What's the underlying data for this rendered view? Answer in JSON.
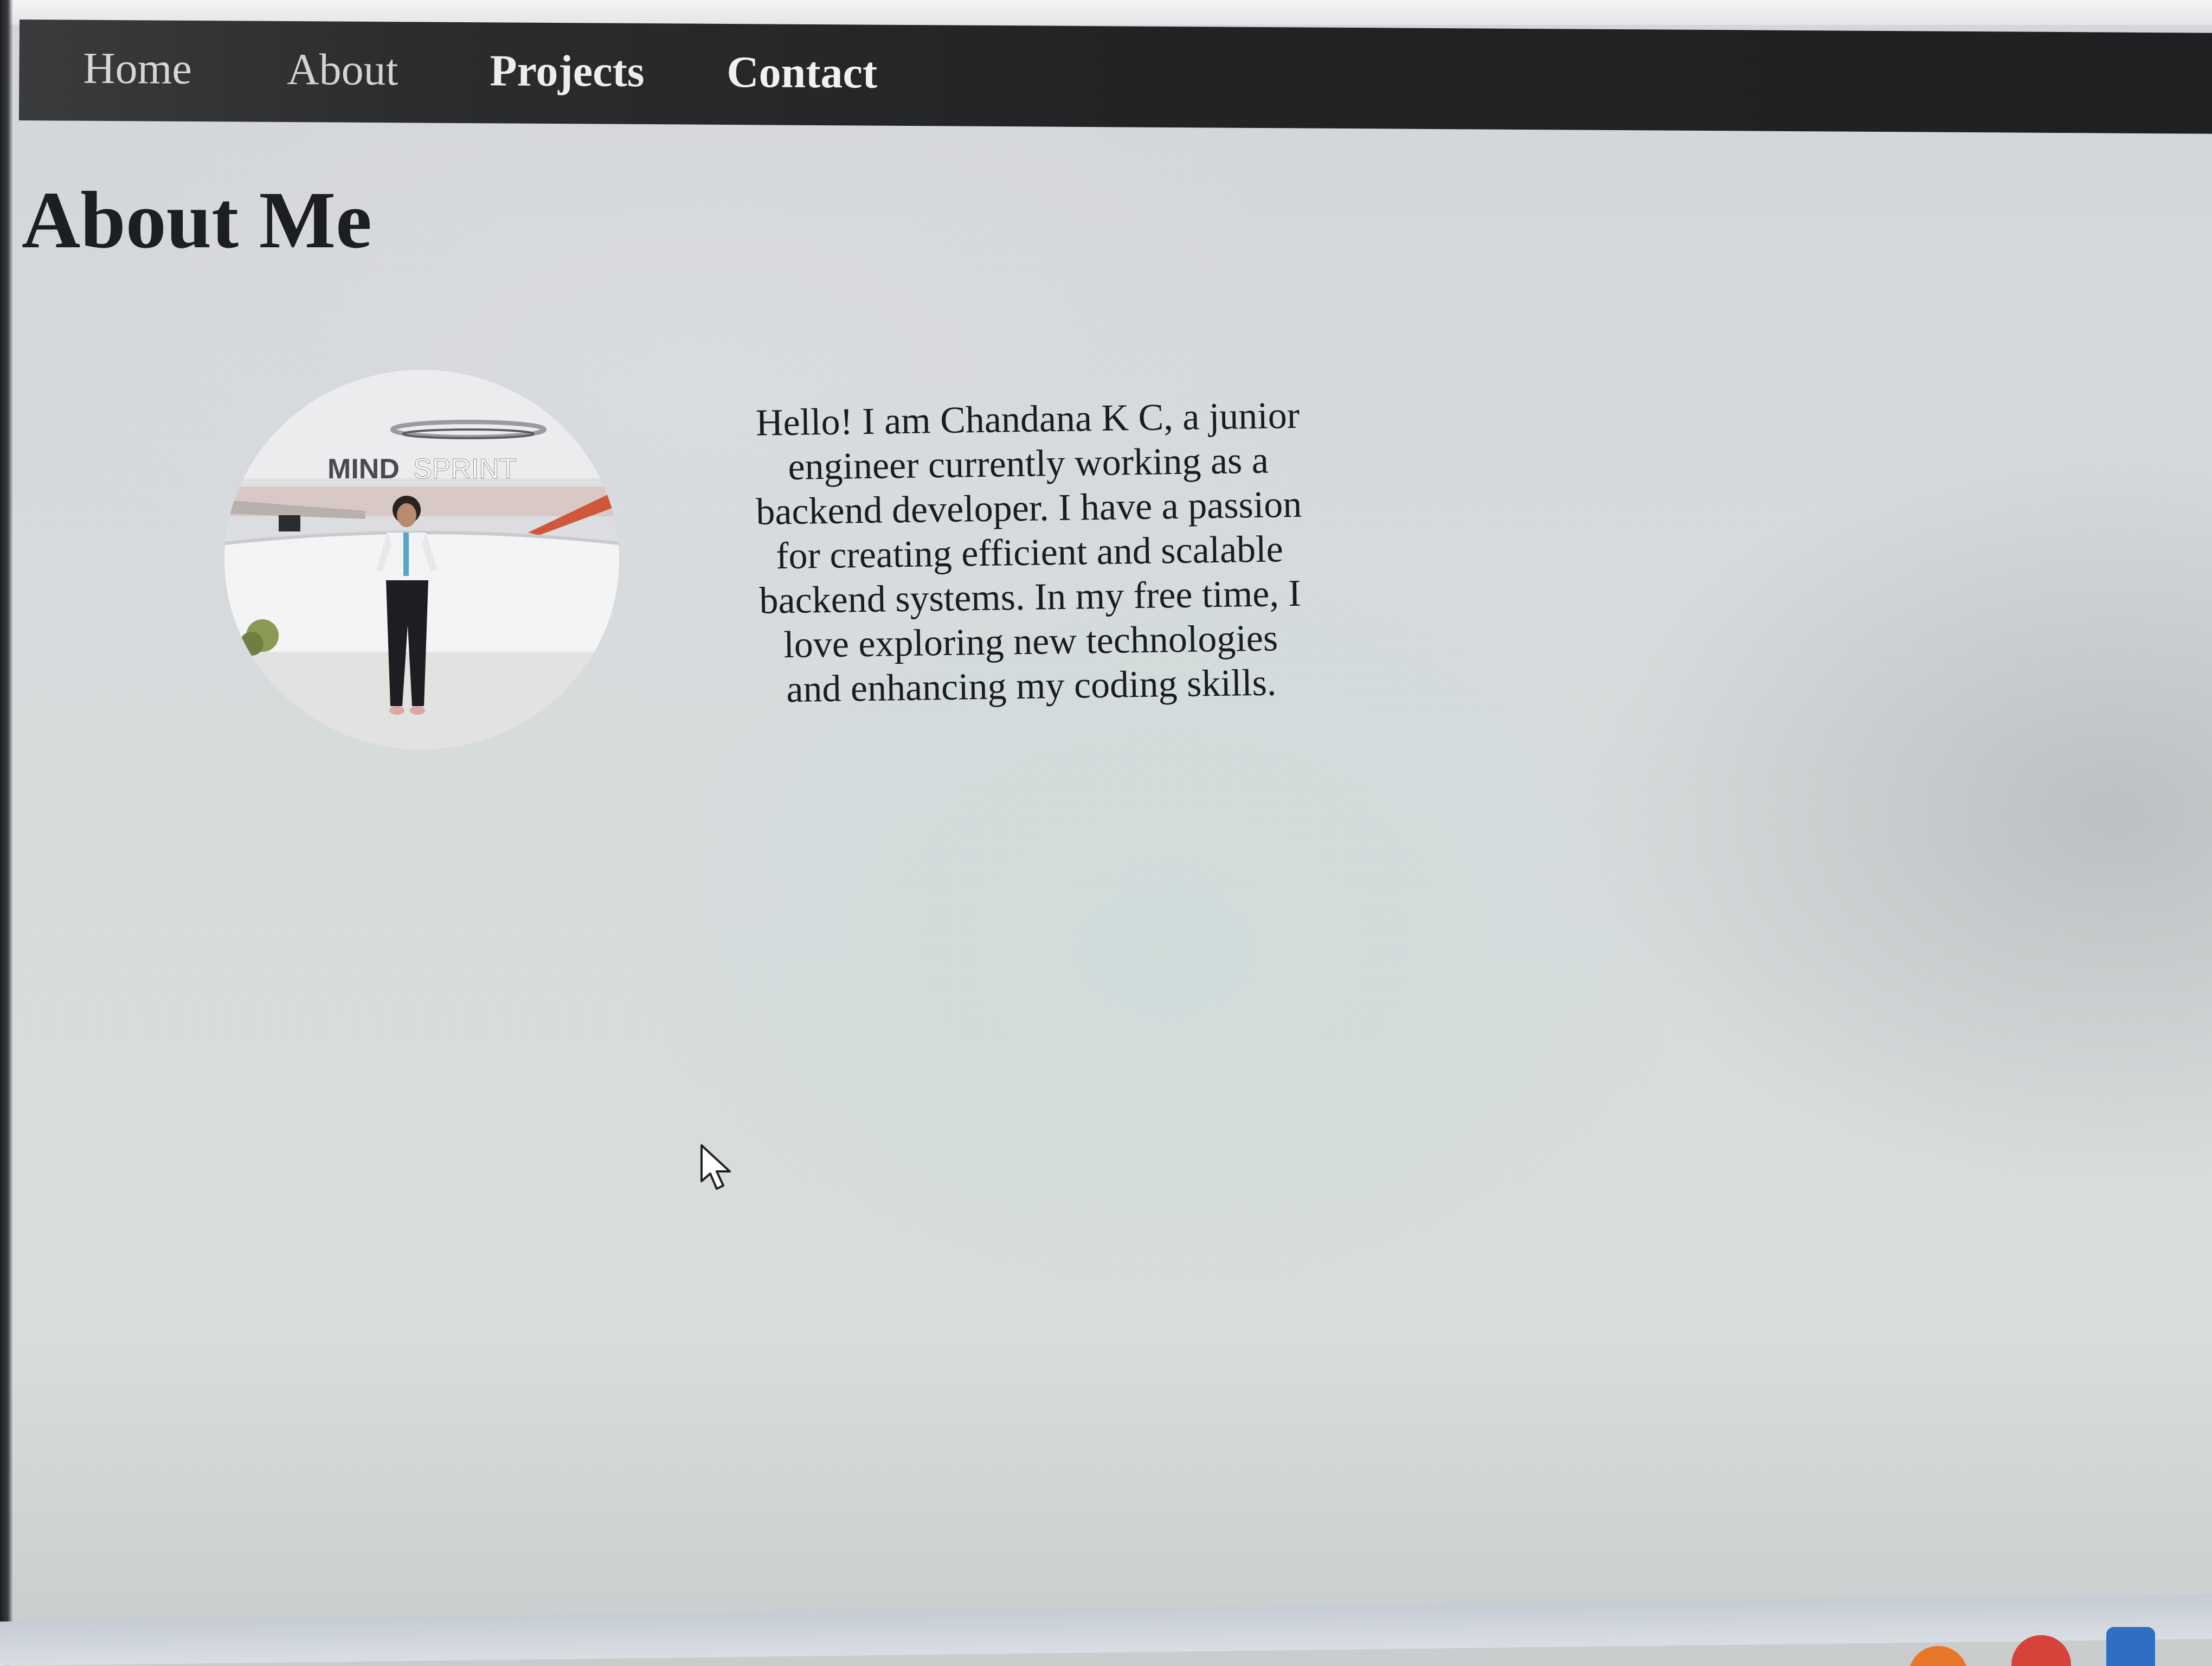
{
  "nav": {
    "items": [
      {
        "label": "Home"
      },
      {
        "label": "About"
      },
      {
        "label": "Projects"
      },
      {
        "label": "Contact"
      }
    ]
  },
  "main": {
    "title": "About Me",
    "photo": {
      "sign_text_dark": "MIND",
      "sign_text_light": "SPRINT"
    },
    "bio": "Hello! I am Chandana K C, a junior engineer currently working as a backend developer. I have a passion for creating efficient and scalable backend systems. In my free time, I love exploring new technologies and enhancing my coding skills."
  },
  "colors": {
    "nav_background": "#222325",
    "nav_text": "#e6e7e8",
    "page_background": "#d6dbdc",
    "text": "#1b1c1e"
  }
}
